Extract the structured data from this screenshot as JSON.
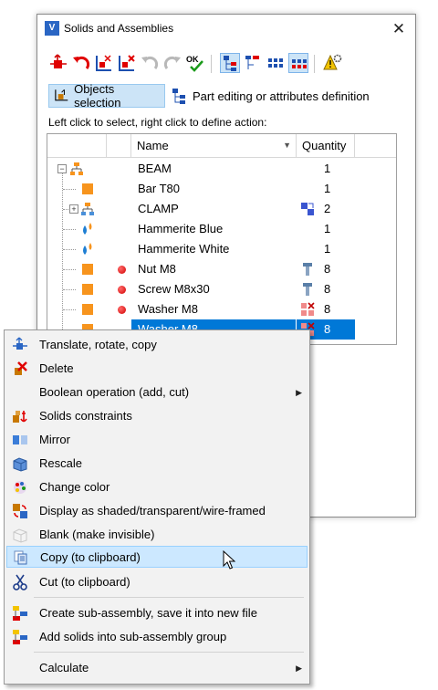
{
  "window": {
    "title": "Solids and Assemblies",
    "close_glyph": "✕",
    "app_icon_letter": "V"
  },
  "modes": {
    "objects_selection": "Objects selection",
    "part_editing": "Part editing or attributes definition"
  },
  "hint": "Left click to select, right click to define action:",
  "columns": {
    "name": "Name",
    "quantity": "Quantity"
  },
  "tree_rows": [
    {
      "name": "BEAM",
      "qty": "1"
    },
    {
      "name": "Bar T80",
      "qty": "1"
    },
    {
      "name": "CLAMP",
      "qty": "2"
    },
    {
      "name": "Hammerite Blue",
      "qty": "1"
    },
    {
      "name": "Hammerite White",
      "qty": "1"
    },
    {
      "name": "Nut M8",
      "qty": "8"
    },
    {
      "name": "Screw M8x30",
      "qty": "8"
    },
    {
      "name": "Washer M8",
      "qty": "8"
    },
    {
      "name": "Washer M8",
      "qty": "8"
    }
  ],
  "menu": {
    "items": [
      {
        "label": "Translate, rotate, copy",
        "icon": "translate-icon"
      },
      {
        "label": "Delete",
        "icon": "delete-icon"
      },
      {
        "label": "Boolean operation (add, cut)",
        "icon": "",
        "submenu": "▶"
      },
      {
        "label": "Solids constraints",
        "icon": "constraints-icon"
      },
      {
        "label": "Mirror",
        "icon": "mirror-icon"
      },
      {
        "label": "Rescale",
        "icon": "rescale-icon"
      },
      {
        "label": "Change color",
        "icon": "color-palette-icon"
      },
      {
        "label": "Display as shaded/transparent/wire-framed",
        "icon": "display-mode-icon"
      },
      {
        "label": "Blank (make invisible)",
        "icon": "blank-icon"
      },
      {
        "label": "Copy (to clipboard)",
        "icon": "copy-icon"
      },
      {
        "label": "Cut (to clipboard)",
        "icon": "cut-icon"
      },
      {
        "label": "Create sub-assembly, save it into new file",
        "icon": "create-subassembly-icon"
      },
      {
        "label": "Add solids into sub-assembly group",
        "icon": "add-subassembly-icon"
      },
      {
        "label": "Calculate",
        "icon": "",
        "submenu": "▶"
      }
    ]
  },
  "toolbar": {
    "ok_label": "OK"
  },
  "colors": {
    "accent": "#0078d7",
    "orange": "#f7941d",
    "blue": "#2a66c4",
    "red": "#e00000"
  }
}
